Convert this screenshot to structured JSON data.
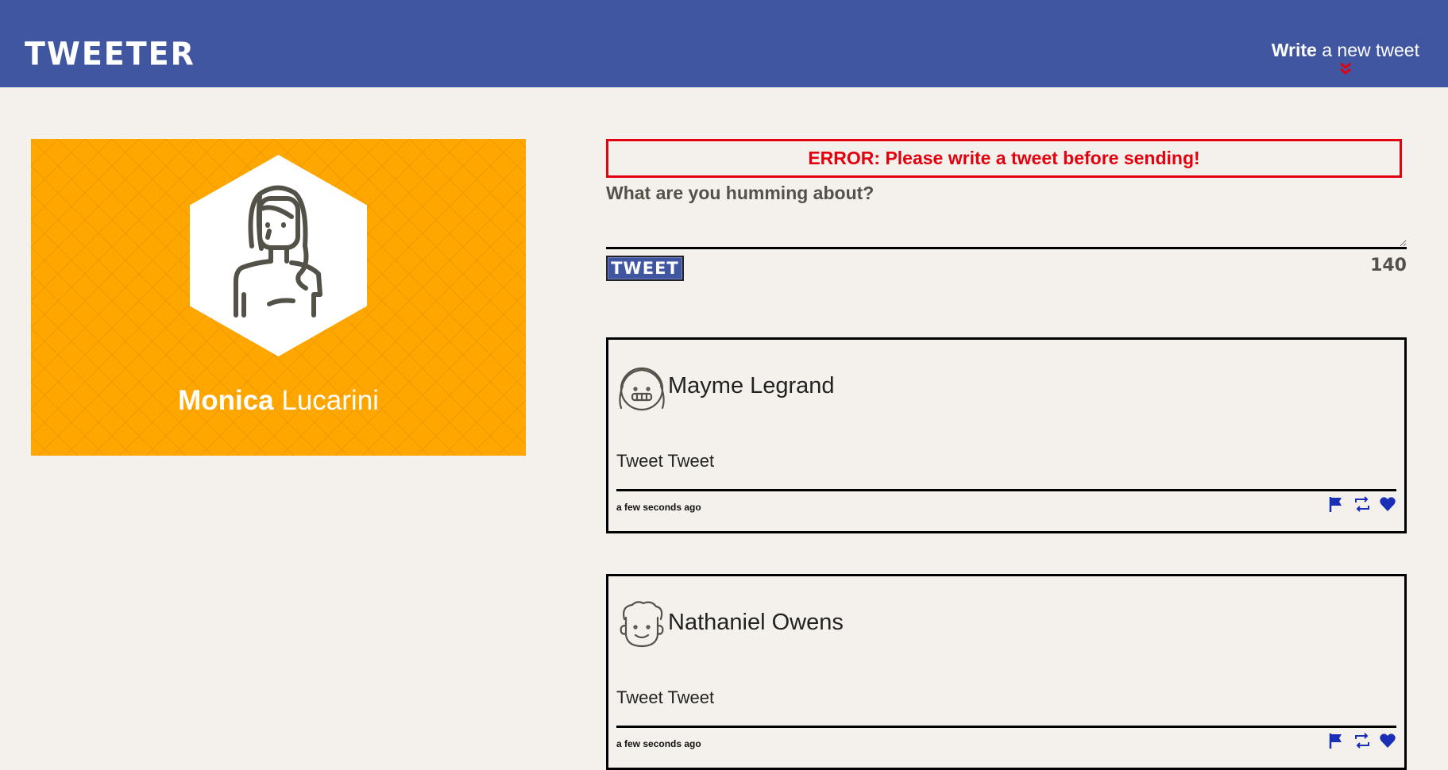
{
  "header": {
    "brand": "TWEETER",
    "compose_bold": "Write",
    "compose_rest": " a new tweet",
    "background_color": "#4056a1",
    "chevron_color": "#e3000f"
  },
  "profile": {
    "first_name": "Monica",
    "last_name": " Lucarini",
    "background_color": "#ffa600"
  },
  "composer": {
    "error": "ERROR: Please write a tweet before sending!",
    "prompt": "What are you humming about?",
    "text_value": "",
    "button_label": "TWEET",
    "counter": "140"
  },
  "tweets": [
    {
      "author": "Mayme Legrand",
      "text": "Tweet Tweet",
      "time": "a few seconds ago",
      "avatar_icon": "girl-avatar-icon"
    },
    {
      "author": "Nathaniel Owens",
      "text": "Tweet Tweet",
      "time": "a few seconds ago",
      "avatar_icon": "boy-avatar-icon"
    }
  ],
  "tweet_actions": [
    "flag-icon",
    "retweet-icon",
    "heart-icon"
  ],
  "colors": {
    "action_icon": "#1a2fb5",
    "error": "#e3000f",
    "page_background": "#f4f1ec"
  }
}
